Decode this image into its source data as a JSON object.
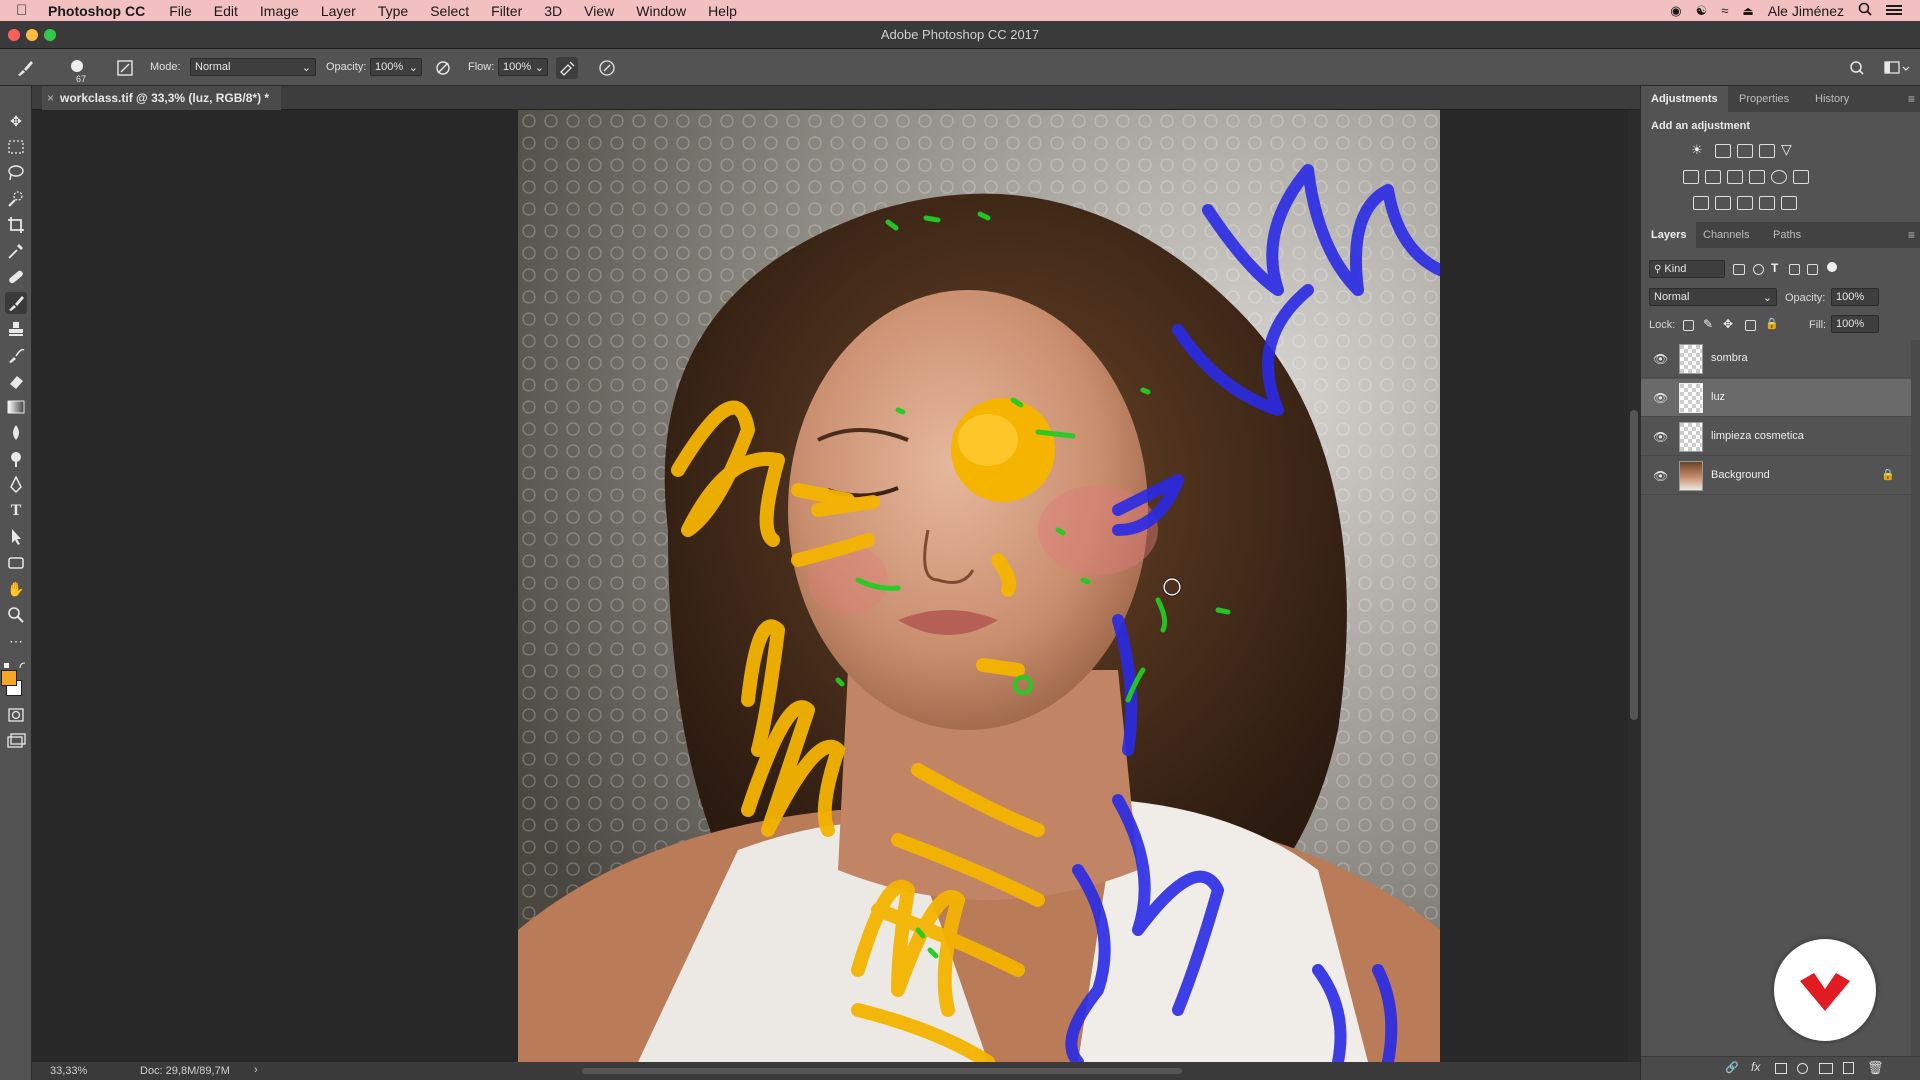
{
  "menubar": {
    "app_name": "Photoshop CC",
    "menus": [
      "File",
      "Edit",
      "Image",
      "Layer",
      "Type",
      "Select",
      "Filter",
      "3D",
      "View",
      "Window",
      "Help"
    ],
    "user": "Ale Jiménez"
  },
  "window": {
    "title": "Adobe Photoshop CC 2017"
  },
  "options_bar": {
    "brush_size": "67",
    "mode_label": "Mode:",
    "mode_value": "Normal",
    "opacity_label": "Opacity:",
    "opacity_value": "100%",
    "flow_label": "Flow:",
    "flow_value": "100%"
  },
  "document": {
    "tab_title": "workclass.tif @ 33,3% (luz, RGB/8*) *"
  },
  "statusbar": {
    "zoom": "33,33%",
    "doc_info": "Doc: 29,8M/89,7M",
    "arrow": "›"
  },
  "adjustments_panel": {
    "tabs": [
      "Adjustments",
      "Properties",
      "History"
    ],
    "heading": "Add an adjustment"
  },
  "layers_panel": {
    "tabs": [
      "Layers",
      "Channels",
      "Paths"
    ],
    "kind_filter": "Kind",
    "blend_mode": "Normal",
    "opacity_label": "Opacity:",
    "opacity_value": "100%",
    "lock_label": "Lock:",
    "fill_label": "Fill:",
    "fill_value": "100%",
    "layers": [
      {
        "name": "sombra",
        "selected": false
      },
      {
        "name": "luz",
        "selected": true
      },
      {
        "name": "limpieza cosmetica",
        "selected": false
      },
      {
        "name": "Background",
        "selected": false,
        "locked": true
      }
    ]
  },
  "colors": {
    "foreground": "#f5a623",
    "background": "#ffffff",
    "menubar": "#f2c0c0",
    "stroke_yellow": "#f4b400",
    "stroke_blue": "#2a2ae6",
    "stroke_green": "#22cc22",
    "logo_red": "#e01b22"
  }
}
